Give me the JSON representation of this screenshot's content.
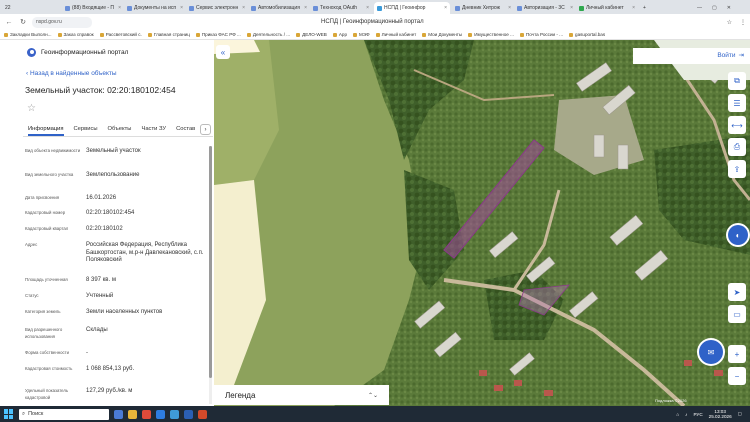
{
  "browser": {
    "tabs": [
      {
        "label": "(88) Входящие - П"
      },
      {
        "label": "Документы на исп"
      },
      {
        "label": "Сервис электронн"
      },
      {
        "label": "Автомобилизация"
      },
      {
        "label": "Техноход OAuth"
      },
      {
        "label": "НСПД | Геоинфор",
        "active": true
      },
      {
        "label": "Дневник Хитрож"
      },
      {
        "label": "Авторизация - 3С"
      },
      {
        "label": "Личный кабинет"
      }
    ],
    "tab_count_badge": "22",
    "url": "nspd.gov.ru",
    "page_title": "НСПД | Геоинформационный портал",
    "bookmarks": [
      "Закладки Выполн...",
      "Заказ справок",
      "Рассветовский с.",
      "Главная страниц",
      "Приказ ФАС РФ ...",
      "Деятельность / ...",
      "ДЕЛО-WEB",
      "App",
      "МЭФ",
      "Личный кабинет",
      "Мои Документы",
      "Имущественное ...",
      "Почта России - ...",
      "gasuportal.bas"
    ]
  },
  "portal": {
    "title": "Геоинформационный портал",
    "back_link": "Назад в найденные объекты",
    "parcel_title": "Земельный участок: 02:20:180102:454",
    "tabs": [
      "Информация",
      "Сервисы",
      "Объекты",
      "Части ЗУ",
      "Состав"
    ],
    "details": [
      {
        "label": "Вид объекта недвижимости",
        "value": "Земельный участок"
      },
      {
        "label": "Вид земельного участка",
        "value": "Землепользование"
      },
      {
        "label": "Дата присвоения",
        "value": "16.01.2026"
      },
      {
        "label": "Кадастровый номер",
        "value": "02:20:180102:454"
      },
      {
        "label": "Кадастровый квартал",
        "value": "02:20:180102"
      },
      {
        "label": "Адрес",
        "value": "Российская Федерация, Республика Башкортостан, м.р-н Давлекановский, с.п. Поляковский"
      },
      {
        "label": "Площадь уточненная",
        "value": "8 397 кв. м"
      },
      {
        "label": "Статус",
        "value": "Учтенный"
      },
      {
        "label": "Категория земель",
        "value": "Земли населенных пунктов"
      },
      {
        "label": "Вид разрешенного использования",
        "value": "Склады"
      },
      {
        "label": "Форма собственности",
        "value": "-"
      },
      {
        "label": "Кадастровая стоимость",
        "value": "1 068 854,13 руб."
      },
      {
        "label": "Удельный показатель кадастровой",
        "value": "127,29 руб./кв. м"
      }
    ]
  },
  "map": {
    "login_label": "Войти",
    "legend_label": "Легенда",
    "attribution": "Подложка ©2026",
    "parcel_color": "#a14a9a"
  },
  "taskbar": {
    "search_label": "Поиск",
    "lang": "РУС",
    "time": "13:03",
    "date": "25.02.2026"
  }
}
